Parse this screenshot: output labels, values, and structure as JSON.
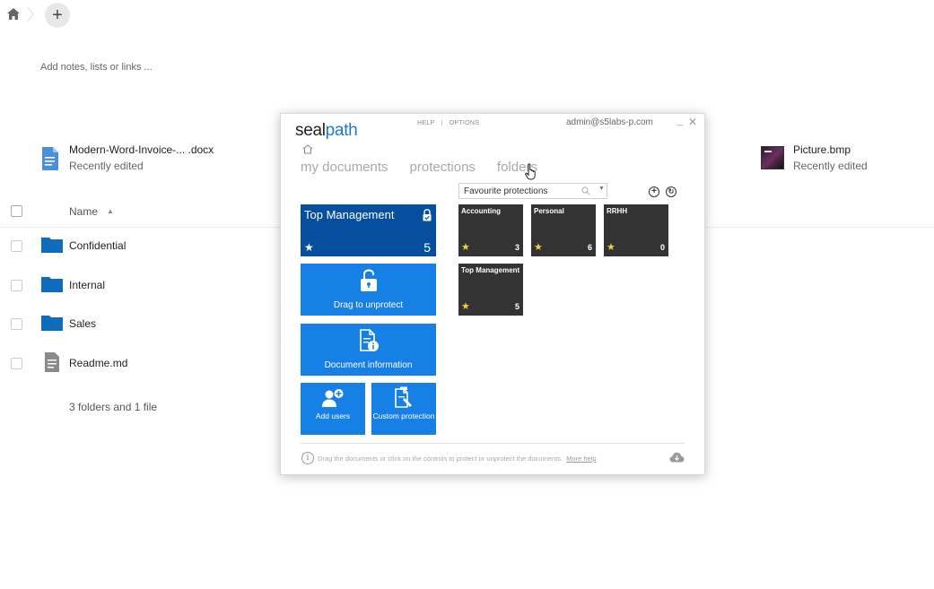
{
  "topbar": {
    "add_label": "+"
  },
  "notes": {
    "placeholder": "Add notes, lists or links ..."
  },
  "recent": [
    {
      "name": "Modern-Word-Invoice-...  .docx",
      "status": "Recently edited"
    },
    {
      "name": "Picture.bmp",
      "status": "Recently edited"
    }
  ],
  "list": {
    "header_name": "Name",
    "sort_indicator": "▲",
    "rows": [
      {
        "name": "Confidential",
        "type": "folder"
      },
      {
        "name": "Internal",
        "type": "folder"
      },
      {
        "name": "Sales",
        "type": "folder"
      },
      {
        "name": "Readme.md",
        "type": "file"
      }
    ],
    "summary": "3 folders and 1 file"
  },
  "colors": {
    "folder": "#0f6cbd",
    "dialog_primary": "#1780e6",
    "dialog_dark_tile": "#064f9e",
    "protection_tile": "#333333",
    "star": "#f2d03b"
  },
  "dialog": {
    "logo_part1": "seal",
    "logo_part2": "path",
    "help": "HELP",
    "options": "OPTIONS",
    "email": "admin@s5labs-p.com",
    "min": "_",
    "close": "✕",
    "tabs": [
      "my documents",
      "protections",
      "folders"
    ],
    "favourites_select": "Favourite protections",
    "add_glyph": "+",
    "refresh_glyph": "↻",
    "main_tile": {
      "title": "Top Management",
      "star": "★",
      "count": "5"
    },
    "actions": {
      "unprotect": "Drag to unprotect",
      "doc_info": "Document information",
      "add_users": "Add users",
      "custom_protection": "Custom protection"
    },
    "protections": [
      {
        "name": "Accounting",
        "count": "3",
        "star": "★"
      },
      {
        "name": "Personal",
        "count": "6",
        "star": "★"
      },
      {
        "name": "RRHH",
        "count": "0",
        "star": "★"
      },
      {
        "name": "Top Management",
        "count": "5",
        "star": "★"
      }
    ],
    "footer_text": "Drag the documents or click on the controls to protect or unprotect the documents.",
    "footer_link": "More help",
    "info_glyph": "i"
  }
}
